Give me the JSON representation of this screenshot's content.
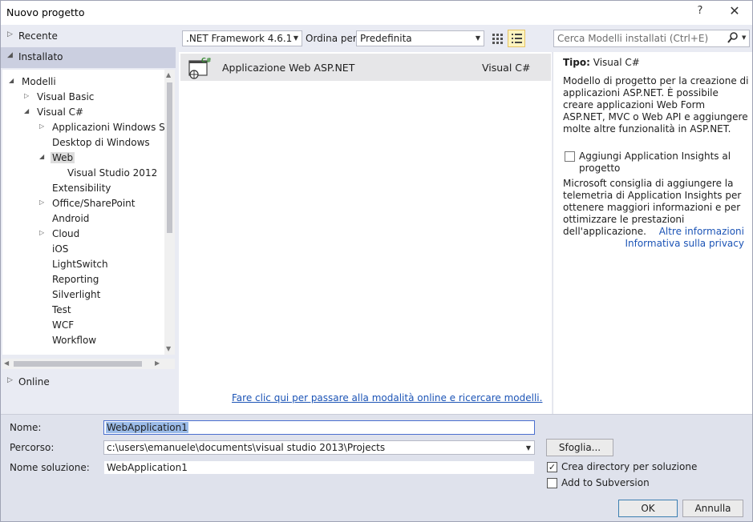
{
  "window": {
    "title": "Nuovo progetto",
    "help_label": "?",
    "close_label": "✕"
  },
  "left": {
    "recente": "Recente",
    "installato": "Installato",
    "online": "Online",
    "tree": [
      {
        "label": "Modelli",
        "arrow": "◢",
        "indent": 0
      },
      {
        "label": "Visual Basic",
        "arrow": "▷",
        "indent": 1
      },
      {
        "label": "Visual C#",
        "arrow": "◢",
        "indent": 1
      },
      {
        "label": "Applicazioni Windows Sto",
        "arrow": "▷",
        "indent": 2
      },
      {
        "label": "Desktop di Windows",
        "arrow": "",
        "indent": 2
      },
      {
        "label": "Web",
        "arrow": "◢",
        "indent": 2,
        "selected": true
      },
      {
        "label": "Visual Studio 2012",
        "arrow": "",
        "indent": 3
      },
      {
        "label": "Extensibility",
        "arrow": "",
        "indent": 2
      },
      {
        "label": "Office/SharePoint",
        "arrow": "▷",
        "indent": 2
      },
      {
        "label": "Android",
        "arrow": "",
        "indent": 2
      },
      {
        "label": "Cloud",
        "arrow": "▷",
        "indent": 2
      },
      {
        "label": "iOS",
        "arrow": "",
        "indent": 2
      },
      {
        "label": "LightSwitch",
        "arrow": "",
        "indent": 2
      },
      {
        "label": "Reporting",
        "arrow": "",
        "indent": 2
      },
      {
        "label": "Silverlight",
        "arrow": "",
        "indent": 2
      },
      {
        "label": "Test",
        "arrow": "",
        "indent": 2
      },
      {
        "label": "WCF",
        "arrow": "",
        "indent": 2
      },
      {
        "label": "Workflow",
        "arrow": "",
        "indent": 2
      }
    ]
  },
  "toolbar": {
    "framework": ".NET Framework 4.6.1",
    "ordina_label": "Ordina per:",
    "ordina_value": "Predefinita",
    "search_placeholder": "Cerca Modelli installati (Ctrl+E)"
  },
  "templates": [
    {
      "name": "Applicazione Web ASP.NET",
      "lang": "Visual C#",
      "badge": "C#"
    }
  ],
  "online_link": "Fare clic qui per passare alla modalità online e ricercare modelli.",
  "details": {
    "tipo_label": "Tipo:",
    "tipo_value": "Visual C#",
    "description": "Modello di progetto per la creazione di applicazioni ASP.NET. È possibile creare applicazioni Web Form ASP.NET, MVC o Web API e aggiungere molte altre funzionalità in ASP.NET.",
    "insights_label": "Aggiungi Application Insights al progetto",
    "telemetry": "Microsoft consiglia di aggiungere la telemetria di Application Insights per ottenere maggiori informazioni e per ottimizzare le prestazioni dell'applicazione.",
    "link_more": "Altre informazioni",
    "link_privacy": "Informativa sulla privacy"
  },
  "form": {
    "nome_label": "Nome:",
    "nome_value": "WebApplication1",
    "percorso_label": "Percorso:",
    "percorso_value": "c:\\users\\emanuele\\documents\\visual studio 2013\\Projects",
    "soluzione_label": "Nome soluzione:",
    "soluzione_value": "WebApplication1",
    "sfoglia": "Sfoglia...",
    "crea_dir_label": "Crea directory per soluzione",
    "subversion_label": "Add to Subversion",
    "ok": "OK",
    "annulla": "Annulla"
  }
}
